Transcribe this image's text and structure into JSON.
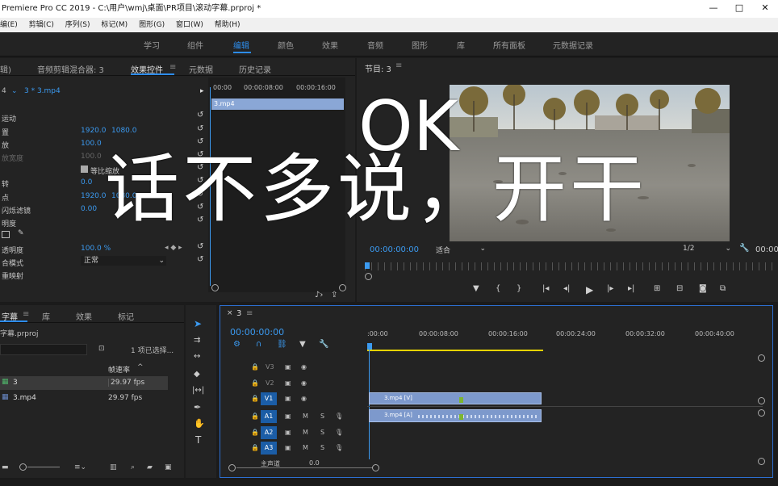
{
  "window": {
    "title": "Premiere Pro CC 2019 - C:\\用户\\wmj\\桌面\\PR项目\\滚动字幕.prproj *",
    "controls": [
      "—",
      "□",
      "✕"
    ]
  },
  "menu": [
    "编(E)",
    "剪辑(C)",
    "序列(S)",
    "标记(M)",
    "图形(G)",
    "窗口(W)",
    "帮助(H)"
  ],
  "workspaces": {
    "items": [
      "学习",
      "组件",
      "编辑",
      "颜色",
      "效果",
      "音频",
      "图形",
      "库",
      "所有面板",
      "元数据记录"
    ],
    "active": "编辑"
  },
  "effect_controls": {
    "tabs": [
      "辑)",
      "音频剪辑混合器: 3",
      "效果控件",
      "元数据",
      "历史记录"
    ],
    "active_tab": "效果控件",
    "source": "3 * 3.mp4",
    "ruler": [
      "00:00",
      "00:00:08:00",
      "00:00:16:00"
    ],
    "clip": "3.mp4",
    "rows": [
      {
        "label": "运动",
        "v1": "",
        "v2": ""
      },
      {
        "label": "置",
        "v1": "1920.0",
        "v2": "1080.0"
      },
      {
        "label": "放",
        "v1": "100.0",
        "v2": ""
      },
      {
        "label": "放宽度",
        "v1": "100.0",
        "v2": ""
      },
      {
        "label": "",
        "v1": "",
        "v2": ""
      },
      {
        "label": "转",
        "v1": "0.0",
        "v2": ""
      },
      {
        "label": "点",
        "v1": "1920.0",
        "v2": "1080.0"
      },
      {
        "label": "闪烁滤镜",
        "v1": "0.00",
        "v2": ""
      },
      {
        "label": "明度",
        "v1": "",
        "v2": ""
      },
      {
        "label": "",
        "v1": "",
        "v2": ""
      },
      {
        "label": "透明度",
        "v1": "100.0 %",
        "v2": ""
      },
      {
        "label": "合模式",
        "v1": "正常",
        "v2": ""
      },
      {
        "label": "重映射",
        "v1": "",
        "v2": ""
      }
    ],
    "uniform_scale": "等比缩放"
  },
  "program": {
    "title": "节目: 3",
    "timecode": "00:00:00:00",
    "fit": "适合",
    "resolution": "1/2",
    "end_timecode": "00:00"
  },
  "overlay": {
    "main": "话不多说，开干",
    "ok": "OK"
  },
  "project": {
    "tabs": [
      "字幕",
      "库",
      "效果",
      "标记"
    ],
    "file": "字幕.prproj",
    "selection": "1 项已选择...",
    "col_rate": "帧速率",
    "items": [
      {
        "name": "3",
        "rate": "29.97 fps"
      },
      {
        "name": "3.mp4",
        "rate": "29.97 fps"
      }
    ]
  },
  "timeline": {
    "tab": "3",
    "timecode": "00:00:00:00",
    "ruler": [
      ":00:00",
      "00:00:08:00",
      "00:00:16:00",
      "00:00:24:00",
      "00:00:32:00",
      "00:00:40:00"
    ],
    "tracks": [
      {
        "name": "V3",
        "target": ""
      },
      {
        "name": "V2",
        "target": ""
      },
      {
        "name": "V1",
        "target": "V1"
      },
      {
        "name": "A1",
        "target": "A1"
      },
      {
        "name": "A2",
        "target": "A2"
      },
      {
        "name": "A3",
        "target": "A3"
      }
    ],
    "master": "主声道",
    "master_value": "0.0",
    "video_clip": "3.mp4 [V]",
    "audio_clip": "3.mp4 [A]"
  },
  "colors": {
    "accent": "#2d8ceb",
    "panel": "#232323",
    "clip": "#7d99cc"
  }
}
